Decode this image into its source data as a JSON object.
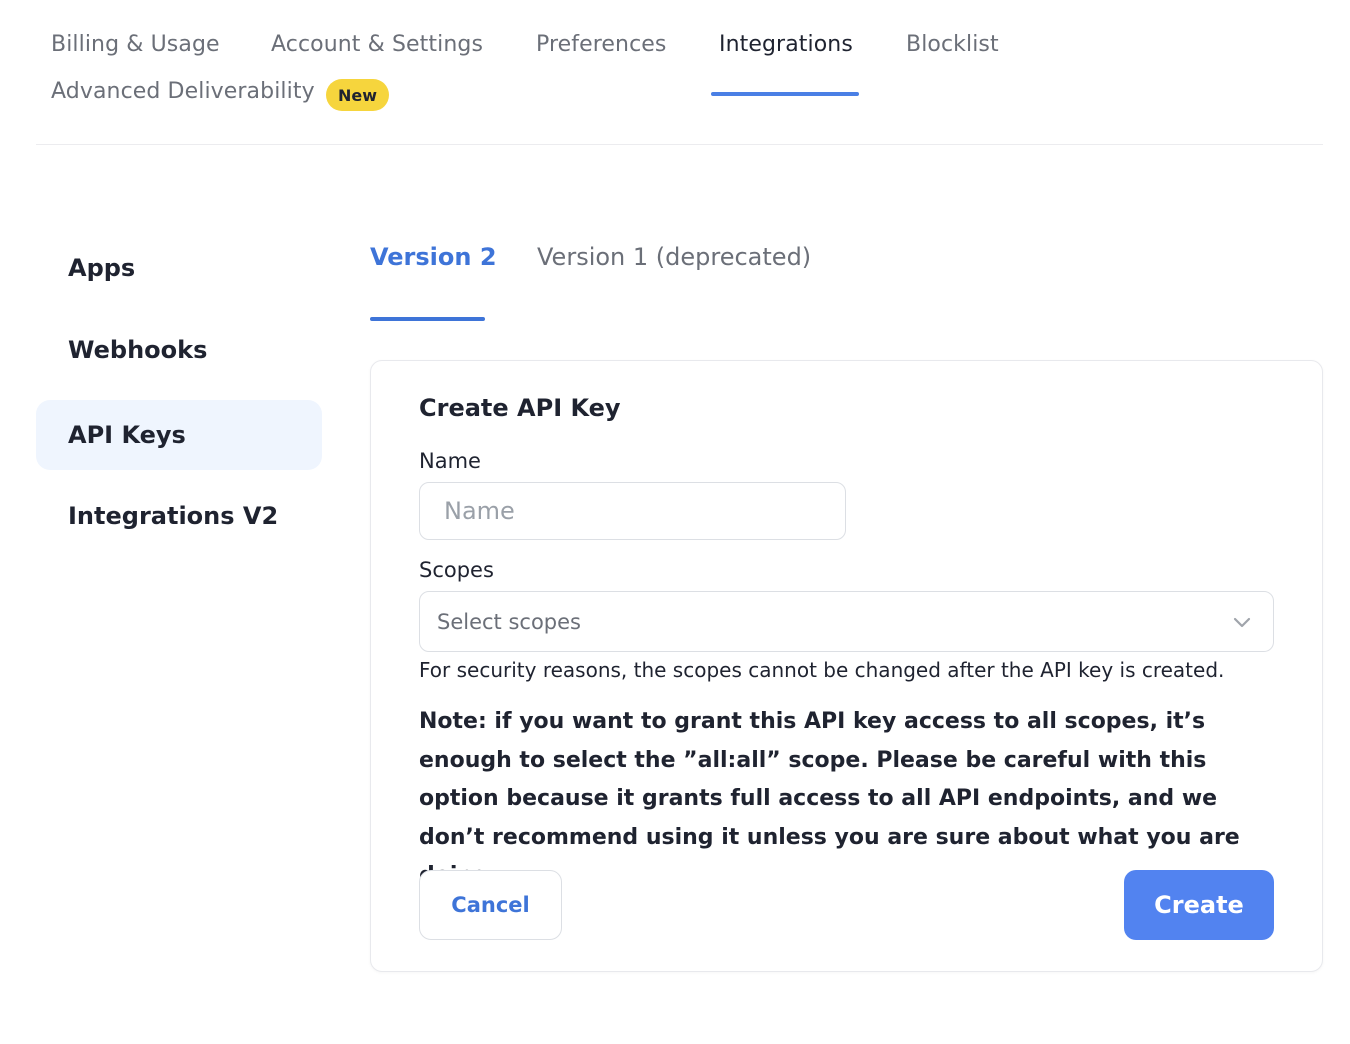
{
  "top_nav": {
    "tabs": [
      {
        "label": "Billing & Usage",
        "active": false
      },
      {
        "label": "Account & Settings",
        "active": false
      },
      {
        "label": "Preferences",
        "active": false
      },
      {
        "label": "Integrations",
        "active": true
      },
      {
        "label": "Blocklist",
        "active": false
      },
      {
        "label": "Advanced Deliverability",
        "active": false,
        "badge": "New"
      }
    ]
  },
  "sidebar": {
    "items": [
      {
        "label": "Apps",
        "active": false
      },
      {
        "label": "Webhooks",
        "active": false
      },
      {
        "label": "API Keys",
        "active": true
      },
      {
        "label": "Integrations V2",
        "active": false
      }
    ]
  },
  "version_tabs": [
    {
      "label": "Version 2",
      "active": true
    },
    {
      "label": "Version 1 (deprecated)",
      "active": false
    }
  ],
  "form": {
    "title": "Create API Key",
    "name_label": "Name",
    "name_placeholder": "Name",
    "name_value": "",
    "scopes_label": "Scopes",
    "scopes_placeholder": "Select scopes",
    "helper_text": "For security reasons, the scopes cannot be changed after the API key is created.",
    "note_text": "Note: if you want to grant this API key access to all scopes, it’s enough to select the ”all:all” scope. Please be careful with this option because it grants full access to all API endpoints, and we don’t recommend using it unless you are sure about what you are doing.",
    "cancel_label": "Cancel",
    "create_label": "Create"
  },
  "icons": {
    "scopes_dropdown": "chevron-down-icon"
  },
  "colors": {
    "accent": "#3e74d8",
    "primary_button": "#5283f0",
    "badge": "#f6d53d",
    "sidebar_active_bg": "#eff5fe"
  }
}
